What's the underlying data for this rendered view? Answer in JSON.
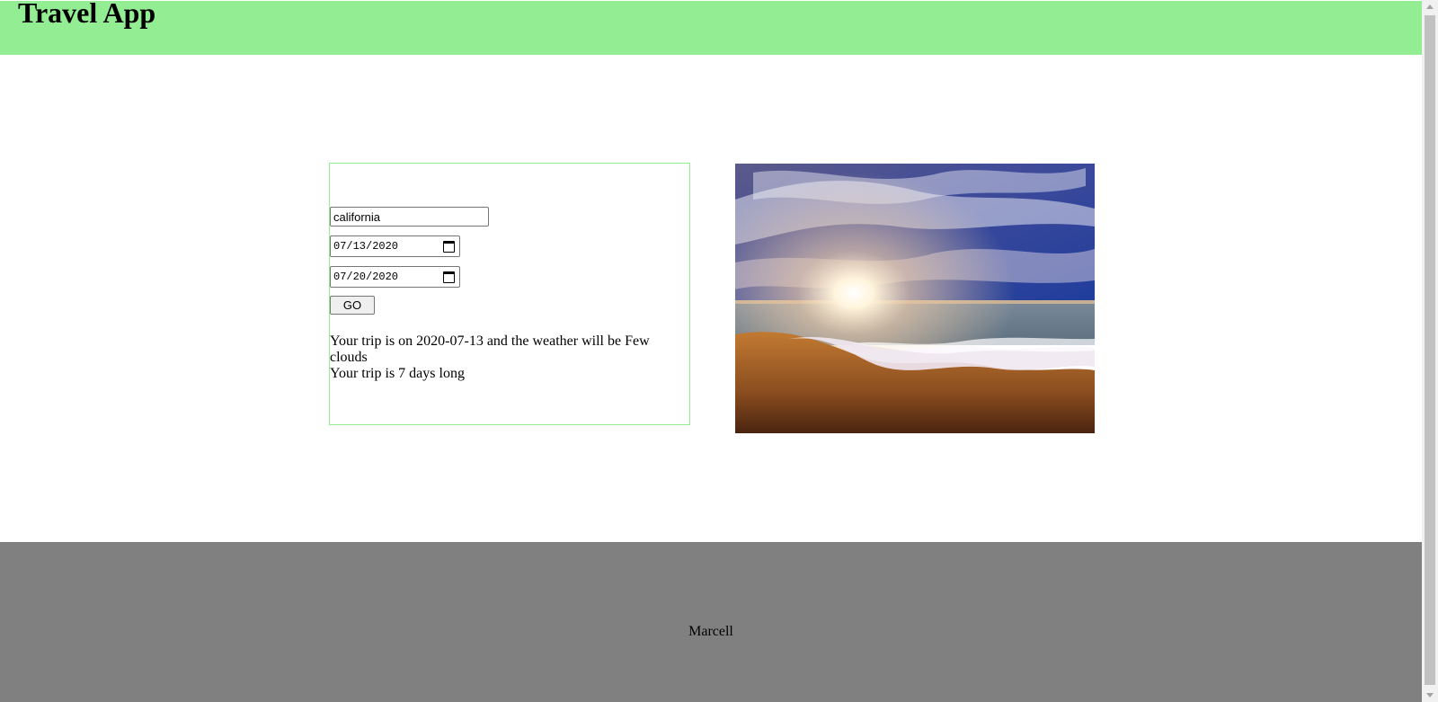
{
  "header": {
    "title": "Travel App"
  },
  "form": {
    "destination_value": "california",
    "start_date": "07/13/2020",
    "end_date": "07/20/2020",
    "go_label": "GO"
  },
  "results": {
    "trip_weather": "Your trip is on 2020-07-13 and the weather will be Few clouds",
    "trip_length": "Your trip is 7 days long"
  },
  "image": {
    "subject": "beach-sunset-photo"
  },
  "footer": {
    "name": "Marcell"
  },
  "colors": {
    "header_bg": "#93ee93",
    "footer_bg": "#808080",
    "form_border": "#93ee93"
  }
}
